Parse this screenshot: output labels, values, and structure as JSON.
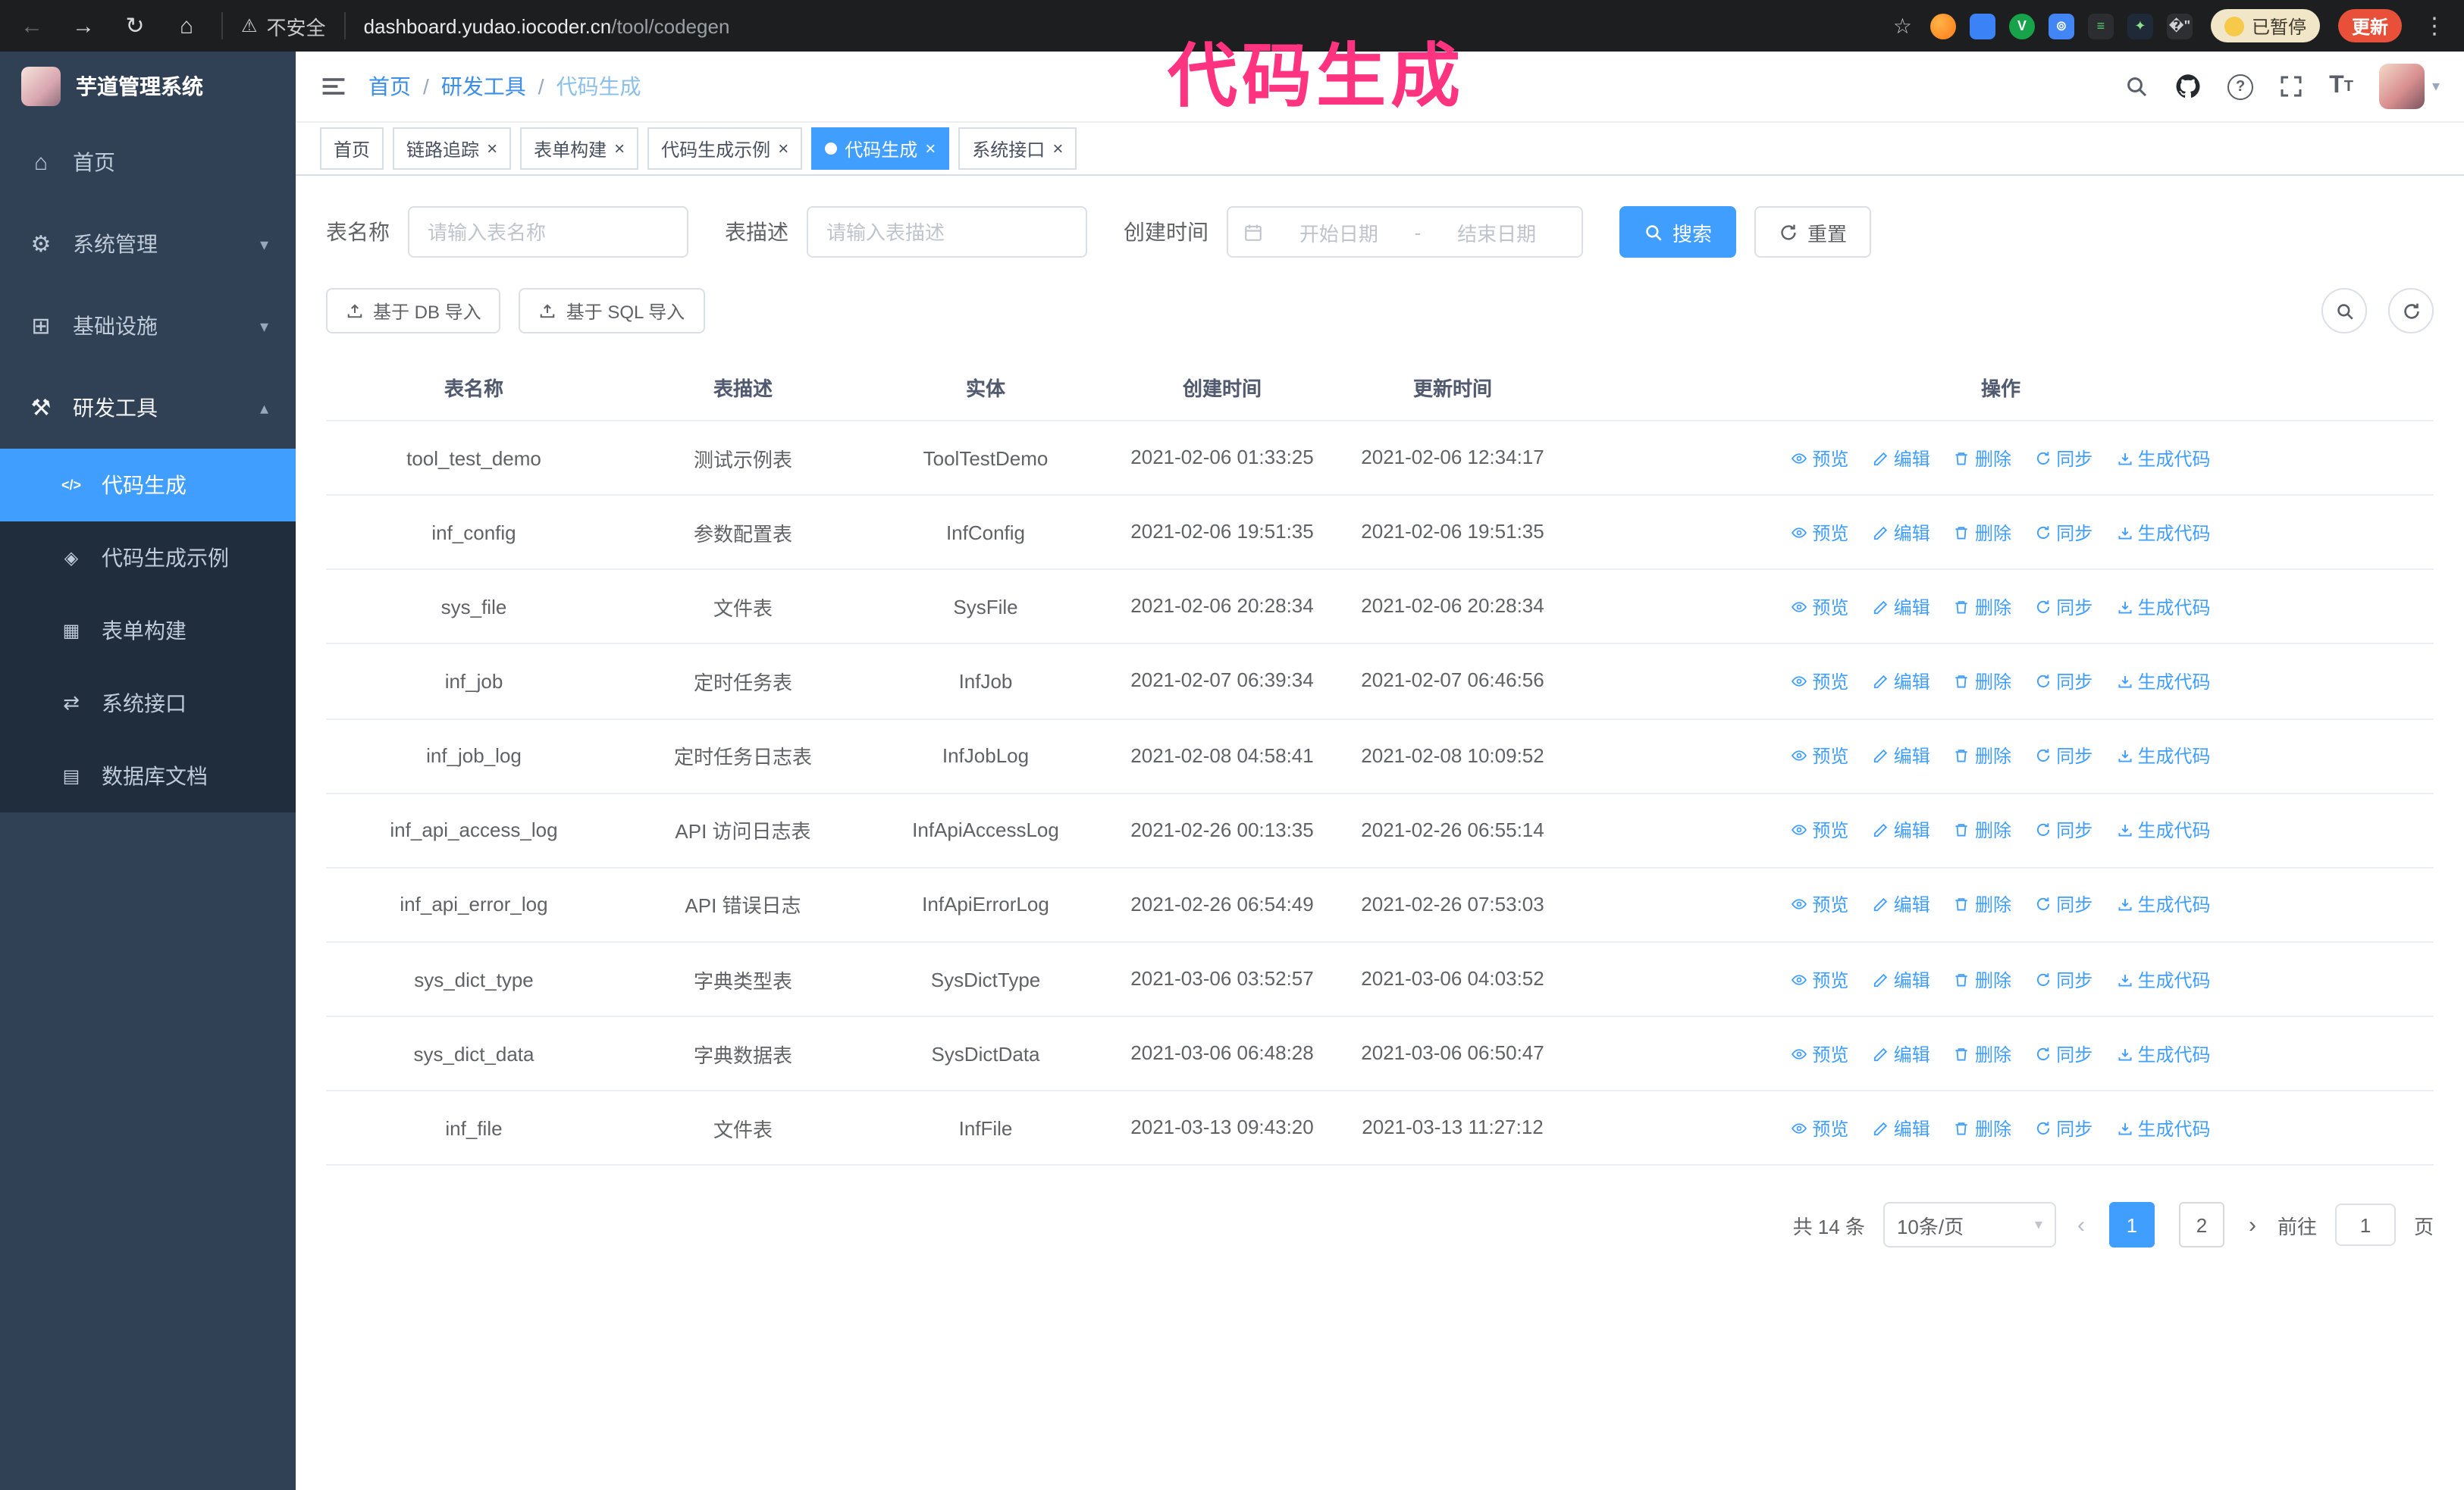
{
  "browser": {
    "security_label": "不安全",
    "url_domain": "dashboard.yudao.iocoder.cn",
    "url_path": "/tool/codegen",
    "paused_badge": "已暂停",
    "update_button": "更新"
  },
  "annotation": {
    "text": "代码生成"
  },
  "sidebar": {
    "logo_title": "芋道管理系统",
    "items": [
      {
        "label": "首页",
        "icon": "home"
      },
      {
        "label": "系统管理",
        "icon": "system",
        "chevron": "down"
      },
      {
        "label": "基础设施",
        "icon": "infra",
        "chevron": "down"
      },
      {
        "label": "研发工具",
        "icon": "tools",
        "chevron": "up",
        "open": true
      }
    ],
    "subitems": [
      {
        "label": "代码生成",
        "icon": "code",
        "active": true
      },
      {
        "label": "代码生成示例",
        "icon": "example",
        "active": false
      },
      {
        "label": "表单构建",
        "icon": "form",
        "active": false
      },
      {
        "label": "系统接口",
        "icon": "api",
        "active": false
      },
      {
        "label": "数据库文档",
        "icon": "db",
        "active": false
      }
    ]
  },
  "header": {
    "breadcrumb": [
      "首页",
      "研发工具",
      "代码生成"
    ],
    "separator": "/"
  },
  "tabs": [
    {
      "label": "首页",
      "closable": false,
      "active": false
    },
    {
      "label": "链路追踪",
      "closable": true,
      "active": false
    },
    {
      "label": "表单构建",
      "closable": true,
      "active": false
    },
    {
      "label": "代码生成示例",
      "closable": true,
      "active": false
    },
    {
      "label": "代码生成",
      "closable": true,
      "active": true
    },
    {
      "label": "系统接口",
      "closable": true,
      "active": false
    }
  ],
  "filters": {
    "table_name_label": "表名称",
    "table_name_placeholder": "请输入表名称",
    "table_desc_label": "表描述",
    "table_desc_placeholder": "请输入表描述",
    "create_time_label": "创建时间",
    "date_start_placeholder": "开始日期",
    "date_separator": "-",
    "date_end_placeholder": "结束日期",
    "search_button": "搜索",
    "reset_button": "重置"
  },
  "toolbar": {
    "import_db": "基于 DB 导入",
    "import_sql": "基于 SQL 导入"
  },
  "table": {
    "columns": [
      "表名称",
      "表描述",
      "实体",
      "创建时间",
      "更新时间",
      "操作"
    ],
    "actions": [
      "预览",
      "编辑",
      "删除",
      "同步",
      "生成代码"
    ],
    "rows": [
      {
        "name": "tool_test_demo",
        "desc": "测试示例表",
        "entity": "ToolTestDemo",
        "created": "2021-02-06 01:33:25",
        "updated": "2021-02-06 12:34:17"
      },
      {
        "name": "inf_config",
        "desc": "参数配置表",
        "entity": "InfConfig",
        "created": "2021-02-06 19:51:35",
        "updated": "2021-02-06 19:51:35"
      },
      {
        "name": "sys_file",
        "desc": "文件表",
        "entity": "SysFile",
        "created": "2021-02-06 20:28:34",
        "updated": "2021-02-06 20:28:34"
      },
      {
        "name": "inf_job",
        "desc": "定时任务表",
        "entity": "InfJob",
        "created": "2021-02-07 06:39:34",
        "updated": "2021-02-07 06:46:56"
      },
      {
        "name": "inf_job_log",
        "desc": "定时任务日志表",
        "entity": "InfJobLog",
        "created": "2021-02-08 04:58:41",
        "updated": "2021-02-08 10:09:52"
      },
      {
        "name": "inf_api_access_log",
        "desc": "API 访问日志表",
        "entity": "InfApiAccessLog",
        "created": "2021-02-26 00:13:35",
        "updated": "2021-02-26 06:55:14"
      },
      {
        "name": "inf_api_error_log",
        "desc": "API 错误日志",
        "entity": "InfApiErrorLog",
        "created": "2021-02-26 06:54:49",
        "updated": "2021-02-26 07:53:03"
      },
      {
        "name": "sys_dict_type",
        "desc": "字典类型表",
        "entity": "SysDictType",
        "created": "2021-03-06 03:52:57",
        "updated": "2021-03-06 04:03:52"
      },
      {
        "name": "sys_dict_data",
        "desc": "字典数据表",
        "entity": "SysDictData",
        "created": "2021-03-06 06:48:28",
        "updated": "2021-03-06 06:50:47"
      },
      {
        "name": "inf_file",
        "desc": "文件表",
        "entity": "InfFile",
        "created": "2021-03-13 09:43:20",
        "updated": "2021-03-13 11:27:12"
      }
    ]
  },
  "pagination": {
    "total": "共 14 条",
    "page_size": "10条/页",
    "pages": [
      {
        "label": "1",
        "active": true
      },
      {
        "label": "2",
        "active": false
      }
    ],
    "goto_label": "前往",
    "goto_value": "1",
    "goto_suffix": "页"
  }
}
